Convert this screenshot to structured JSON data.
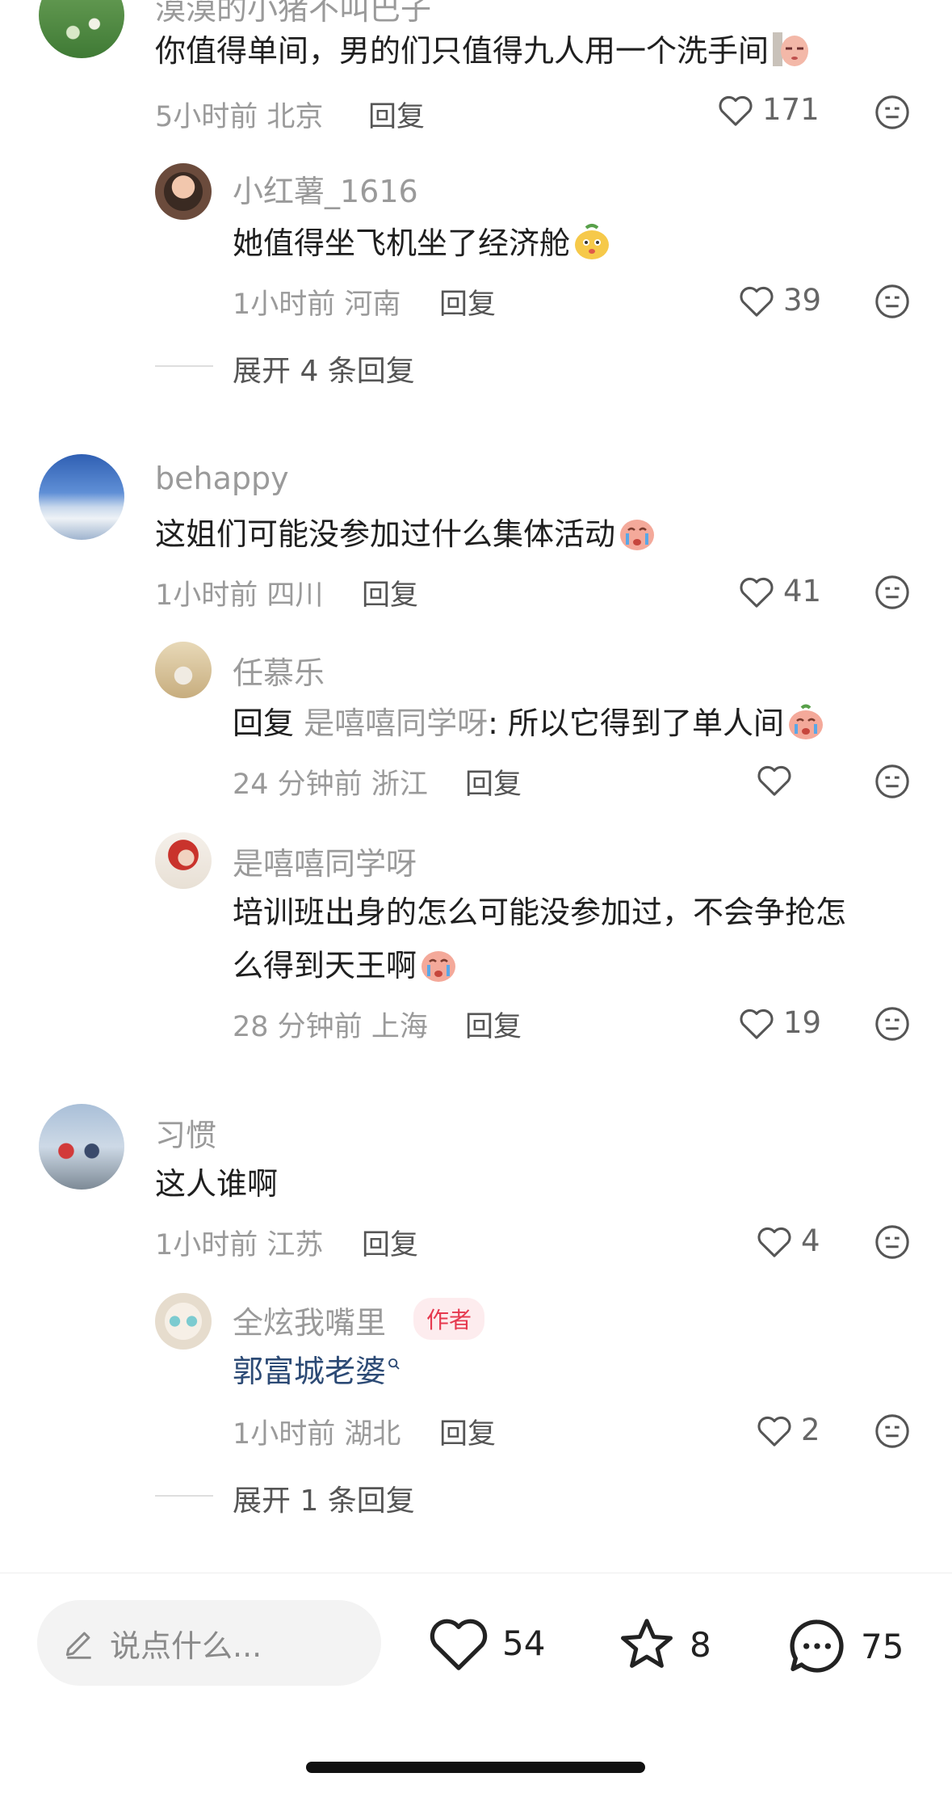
{
  "comments": [
    {
      "username": "漠漠的小猪不叫巴子",
      "text": "你值得单间，男的们只值得九人用一个洗手间",
      "time": "5小时前",
      "location": "北京",
      "reply_label": "回复",
      "likes": "171"
    },
    {
      "username": "小红薯_1616",
      "text": "她值得坐飞机坐了经济舱",
      "time": "1小时前",
      "location": "河南",
      "reply_label": "回复",
      "likes": "39",
      "expand": "展开 4 条回复"
    },
    {
      "username": "behappy",
      "text": "这姐们可能没参加过什么集体活动",
      "time": "1小时前",
      "location": "四川",
      "reply_label": "回复",
      "likes": "41"
    },
    {
      "username": "任慕乐",
      "reply_prefix": "回复",
      "reply_to": "是嘻嘻同学呀",
      "text": ": 所以它得到了单人间",
      "time": "24 分钟前",
      "location": "浙江",
      "reply_label": "回复",
      "likes": ""
    },
    {
      "username": "是嘻嘻同学呀",
      "text_line1": "培训班出身的怎么可能没参加过，不会争抢怎",
      "text_line2": "么得到天王啊",
      "time": "28 分钟前",
      "location": "上海",
      "reply_label": "回复",
      "likes": "19"
    },
    {
      "username": "习惯",
      "text": "这人谁啊",
      "time": "1小时前",
      "location": "江苏",
      "reply_label": "回复",
      "likes": "4"
    },
    {
      "username": "全炫我嘴里",
      "author_tag": "作者",
      "text": "郭富城老婆",
      "time": "1小时前",
      "location": "湖北",
      "reply_label": "回复",
      "likes": "2",
      "expand": "展开 1 条回复"
    }
  ],
  "bottom_bar": {
    "input_placeholder": "说点什么...",
    "like_count": "54",
    "star_count": "8",
    "comment_count": "75"
  },
  "icons": [
    "heart-icon",
    "neutral-face-icon",
    "pencil-icon",
    "star-icon",
    "comment-bubble-icon",
    "search-link-icon"
  ]
}
